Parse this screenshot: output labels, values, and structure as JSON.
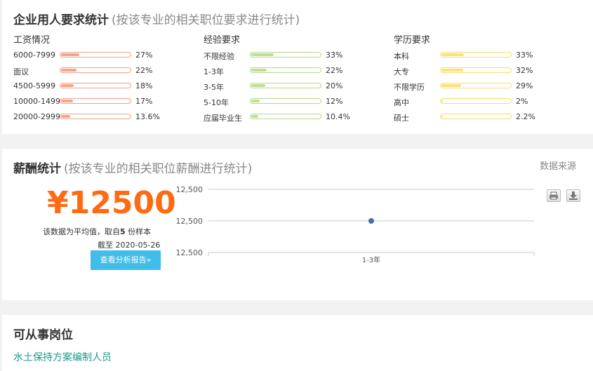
{
  "requirements": {
    "title": "企业用人要求统计",
    "subtitle": "(按该专业的相关职位要求进行统计)",
    "columns": [
      {
        "title": "工资情况",
        "color": "red",
        "rows": [
          {
            "label": "6000-7999",
            "pct_text": "27%",
            "pct": 27
          },
          {
            "label": "面议",
            "pct_text": "22%",
            "pct": 22
          },
          {
            "label": "4500-5999",
            "pct_text": "18%",
            "pct": 18
          },
          {
            "label": "10000-1499",
            "pct_text": "17%",
            "pct": 17
          },
          {
            "label": "20000-2999",
            "pct_text": "13.6%",
            "pct": 13.6
          }
        ]
      },
      {
        "title": "经验要求",
        "color": "green",
        "rows": [
          {
            "label": "不限经验",
            "pct_text": "33%",
            "pct": 33
          },
          {
            "label": "1-3年",
            "pct_text": "22%",
            "pct": 22
          },
          {
            "label": "3-5年",
            "pct_text": "20%",
            "pct": 20
          },
          {
            "label": "5-10年",
            "pct_text": "12%",
            "pct": 12
          },
          {
            "label": "应届毕业生",
            "pct_text": "10.4%",
            "pct": 10.4
          }
        ]
      },
      {
        "title": "学历要求",
        "color": "yellow",
        "rows": [
          {
            "label": "本科",
            "pct_text": "33%",
            "pct": 33
          },
          {
            "label": "大专",
            "pct_text": "32%",
            "pct": 32
          },
          {
            "label": "不限学历",
            "pct_text": "29%",
            "pct": 29
          },
          {
            "label": "高中",
            "pct_text": "2%",
            "pct": 2
          },
          {
            "label": "硕士",
            "pct_text": "2.2%",
            "pct": 2.2
          }
        ]
      }
    ]
  },
  "salary": {
    "title": "薪酬统计",
    "subtitle": "(按该专业的相关职位薪酬进行统计)",
    "source_link": "数据来源",
    "amount": "¥12500",
    "note_prefix": "该数据为平均值，取自",
    "sample_count": "5",
    "note_suffix": "份样本",
    "date_note": "截至 2020-05-26",
    "report_button": "查看分析报告»",
    "print_icon": "print-icon",
    "download_icon": "download-icon"
  },
  "chart_data": {
    "type": "line",
    "categories": [
      "1-3年"
    ],
    "series": [
      {
        "values": [
          12500
        ]
      }
    ],
    "yticks": [
      "12,500",
      "12,500",
      "12,500"
    ],
    "ylim": [
      12499,
      12501
    ],
    "grid": true,
    "color": "#4572a7"
  },
  "jobs": {
    "title": "可从事岗位",
    "items": [
      "水土保持方案编制人员"
    ]
  }
}
